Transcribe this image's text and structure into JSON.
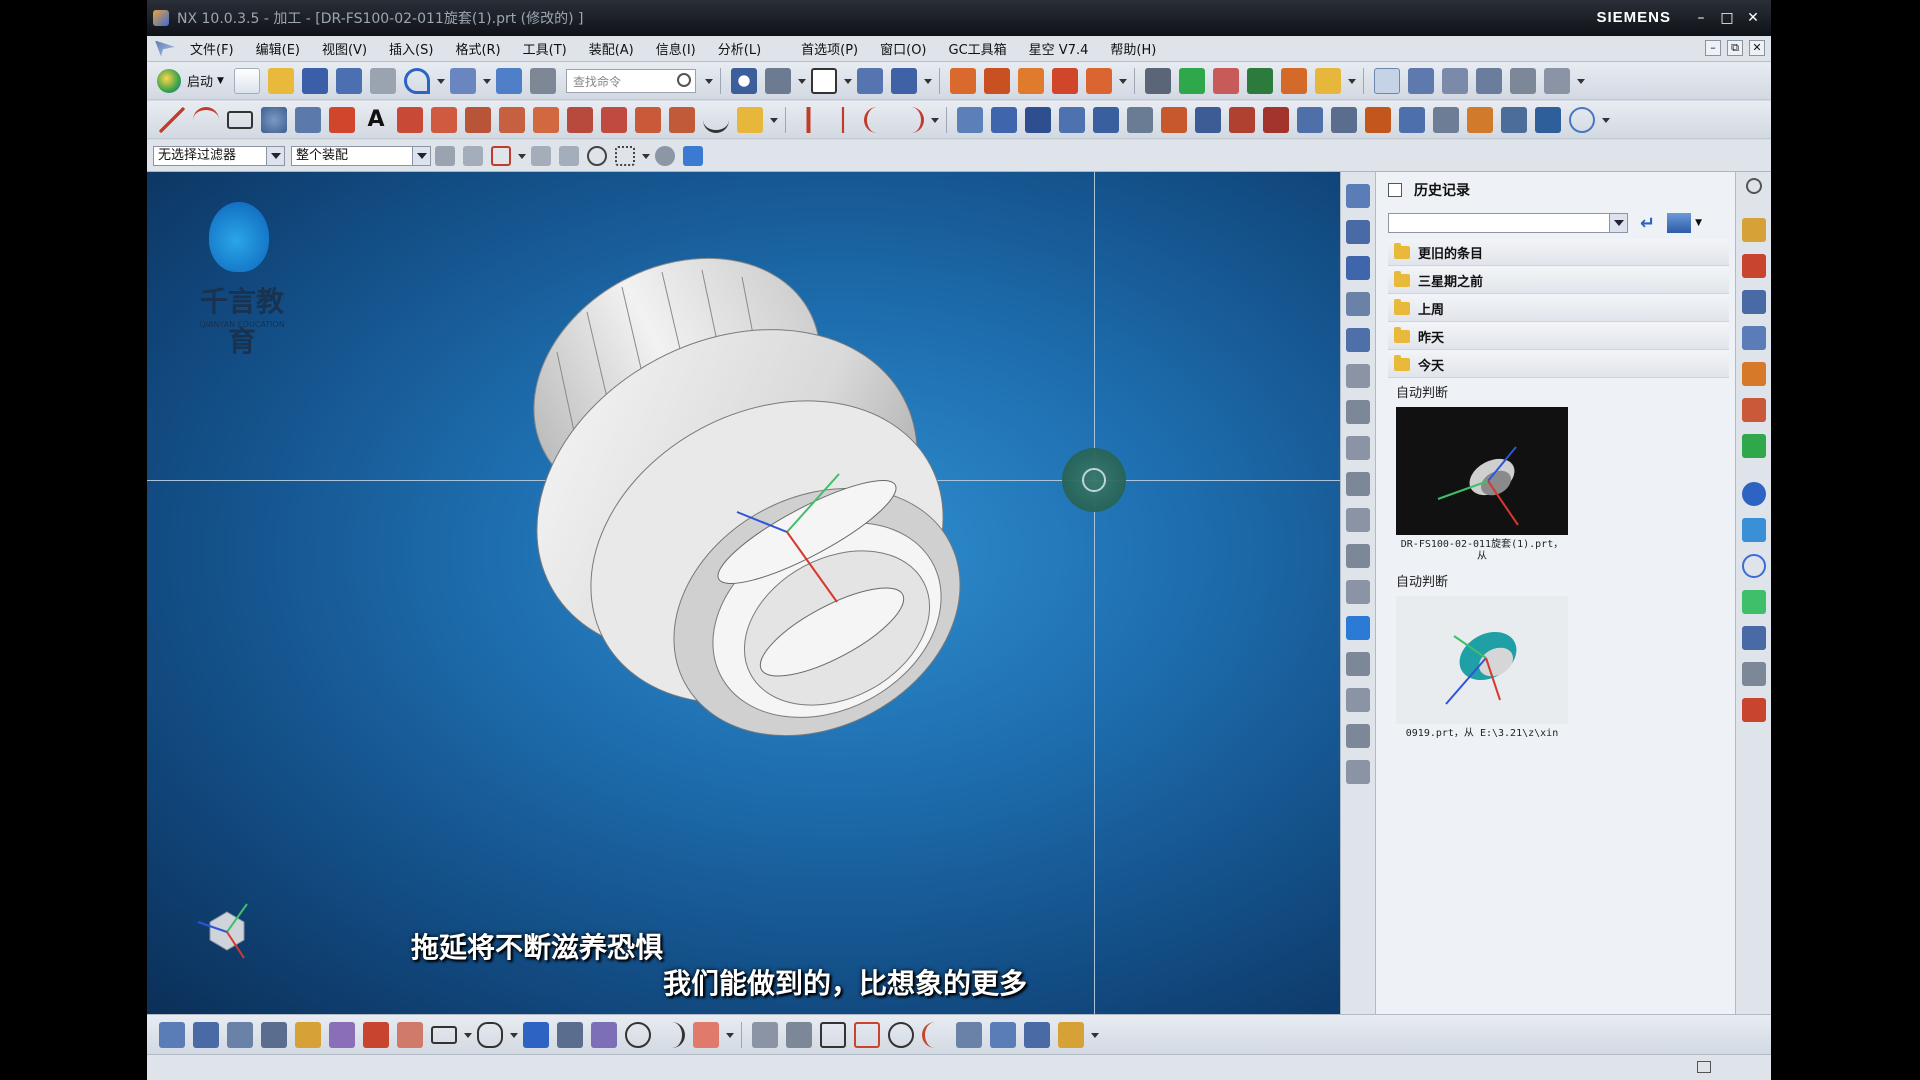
{
  "window": {
    "title": "NX 10.0.3.5 - 加工 - [DR-FS100-02-011旋套(1).prt  (修改的) ]",
    "brand": "SIEMENS",
    "controls": [
      "minimize",
      "maximize",
      "close"
    ]
  },
  "menu": {
    "items": [
      "文件(F)",
      "编辑(E)",
      "视图(V)",
      "插入(S)",
      "格式(R)",
      "工具(T)",
      "装配(A)",
      "信息(I)",
      "分析(L)",
      "首选项(P)",
      "窗口(O)",
      "GC工具箱",
      "星空 V7.4",
      "帮助(H)"
    ]
  },
  "toolbar": {
    "start_label": "启动",
    "search_placeholder": "查找命令"
  },
  "selection": {
    "filter": "无选择过滤器",
    "scope": "整个装配"
  },
  "viewport": {
    "subtitle_line1": "拖延将不断滋养恐惧",
    "subtitle_line2": "我们能做到的，比想象的更多",
    "watermark_name": "千言教育",
    "watermark_sub": "QIANYAN EDUCATION",
    "background_color": "#1e6eaf"
  },
  "history": {
    "title": "历史记录",
    "folders": [
      "更旧的条目",
      "三星期之前",
      "上周",
      "昨天",
      "今天"
    ],
    "entries": [
      {
        "group": "自动判断",
        "caption": "DR-FS100-02-011旋套(1).prt，从"
      },
      {
        "group": "自动判断",
        "caption": "0919.prt，从 E:\\3.21\\z\\xin"
      }
    ]
  },
  "icons": {
    "history_settings": "gear-icon",
    "history_back": "back-arrow-icon",
    "viewport_cursor": "crosshair-icon"
  }
}
